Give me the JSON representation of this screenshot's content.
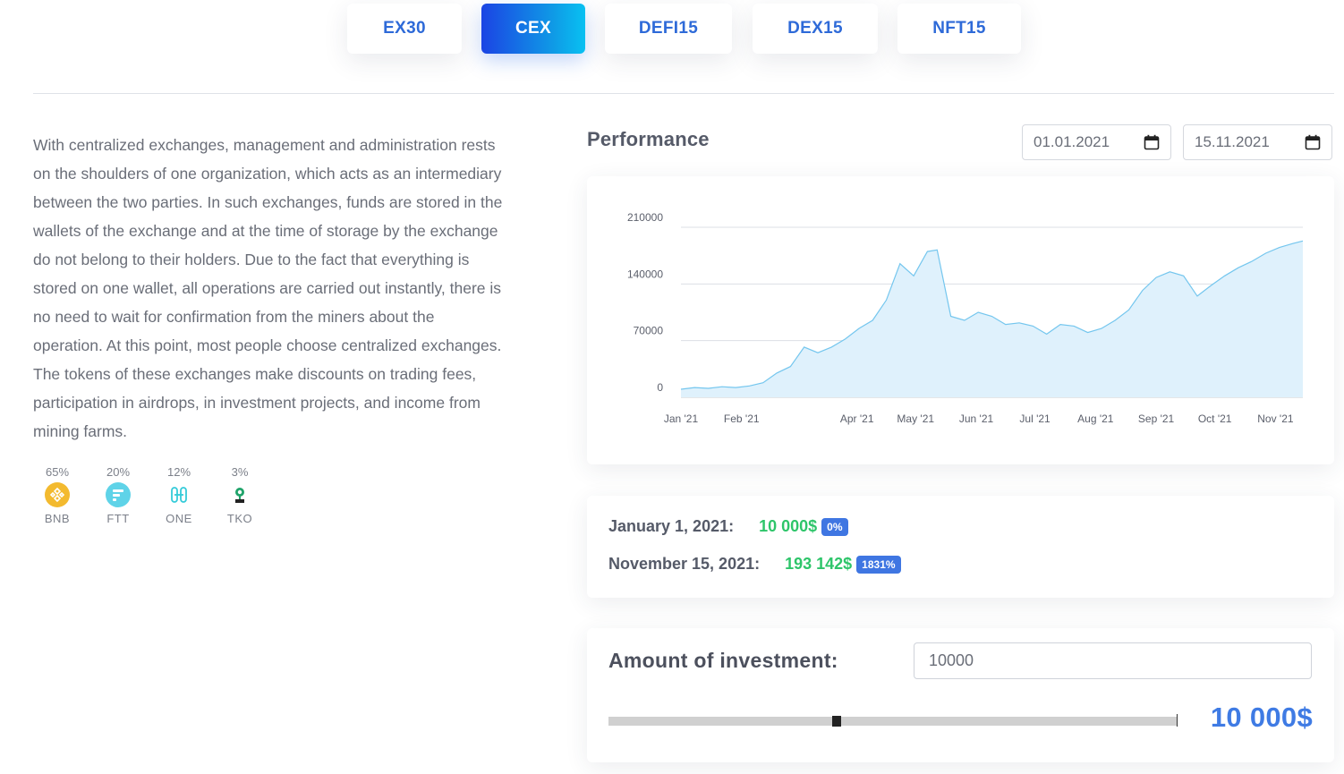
{
  "tabs": [
    {
      "label": "EX30",
      "active": false
    },
    {
      "label": "CEX",
      "active": true
    },
    {
      "label": "DEFI15",
      "active": false
    },
    {
      "label": "DEX15",
      "active": false
    },
    {
      "label": "NFT15",
      "active": false
    }
  ],
  "description": "With centralized exchanges, management and administration rests on the shoulders of one organization, which acts as an intermediary between the two parties. In such exchanges, funds are stored in the wallets of the exchange and at the time of storage by the exchange do not belong to their holders. Due to the fact that everything is stored on one wallet, all operations are carried out instantly, there is no need to wait for confirmation from the miners about the operation. At this point, most people choose centralized exchanges. The tokens of these exchanges make discounts on trading fees, participation in airdrops, in investment projects, and income from mining farms.",
  "tokens": [
    {
      "percent": "65%",
      "symbol": "BNB",
      "icon": "bnb-icon",
      "color": "#f3ba2f"
    },
    {
      "percent": "20%",
      "symbol": "FTT",
      "icon": "ftt-icon",
      "color": "#5fd3e8"
    },
    {
      "percent": "12%",
      "symbol": "ONE",
      "icon": "harmony-one-icon",
      "color": "#34cbd9"
    },
    {
      "percent": "3%",
      "symbol": "TKO",
      "icon": "tko-icon",
      "color": "#1fa36a"
    }
  ],
  "performance": {
    "title": "Performance",
    "date_from": "01.01.2021",
    "date_to": "15.11.2021"
  },
  "chart_data": {
    "type": "area",
    "title": "",
    "xlabel": "",
    "ylabel": "",
    "ylim": [
      0,
      210000
    ],
    "yticks": [
      "210000",
      "140000",
      "70000",
      "0"
    ],
    "xticks": [
      "Jan '21",
      "Feb '21",
      "Apr '21",
      "May '21",
      "Jun '21",
      "Jul '21",
      "Aug '21",
      "Sep '21",
      "Oct '21",
      "Nov '21"
    ],
    "xtick_dates": [
      "2021-01-01",
      "2021-02-01",
      "2021-04-01",
      "2021-05-01",
      "2021-06-01",
      "2021-07-01",
      "2021-08-01",
      "2021-09-01",
      "2021-10-01",
      "2021-11-01"
    ],
    "grid": true,
    "line_color": "#74c6ee",
    "fill_color": "#dff1fc",
    "x": [
      "2021-01-01",
      "2021-01-08",
      "2021-01-15",
      "2021-01-22",
      "2021-01-29",
      "2021-02-05",
      "2021-02-12",
      "2021-02-19",
      "2021-02-26",
      "2021-03-05",
      "2021-03-12",
      "2021-03-19",
      "2021-03-26",
      "2021-04-02",
      "2021-04-09",
      "2021-04-16",
      "2021-04-23",
      "2021-04-30",
      "2021-05-07",
      "2021-05-12",
      "2021-05-19",
      "2021-05-26",
      "2021-06-02",
      "2021-06-09",
      "2021-06-16",
      "2021-06-23",
      "2021-06-30",
      "2021-07-07",
      "2021-07-14",
      "2021-07-21",
      "2021-07-28",
      "2021-08-04",
      "2021-08-11",
      "2021-08-18",
      "2021-08-25",
      "2021-09-01",
      "2021-09-08",
      "2021-09-15",
      "2021-09-22",
      "2021-09-29",
      "2021-10-06",
      "2021-10-13",
      "2021-10-20",
      "2021-10-27",
      "2021-11-03",
      "2021-11-10",
      "2021-11-15"
    ],
    "values": [
      10000,
      12000,
      11000,
      13000,
      12000,
      14000,
      18000,
      30000,
      38000,
      62000,
      55000,
      62000,
      72000,
      85000,
      95000,
      120000,
      165000,
      150000,
      180000,
      182000,
      100000,
      95000,
      105000,
      100000,
      90000,
      92000,
      88000,
      78000,
      90000,
      88000,
      80000,
      85000,
      95000,
      108000,
      132000,
      148000,
      155000,
      150000,
      125000,
      138000,
      150000,
      160000,
      168000,
      178000,
      185000,
      190000,
      193142
    ]
  },
  "summary": [
    {
      "label": "January 1, 2021:",
      "value": "10 000$",
      "badge": "0%"
    },
    {
      "label": "November 15, 2021:",
      "value": "193 142$",
      "badge": "1831%"
    }
  ],
  "investment": {
    "label": "Amount of investment:",
    "input_value": "10000",
    "amount_display": "10 000$",
    "slider_level": 0.4
  }
}
